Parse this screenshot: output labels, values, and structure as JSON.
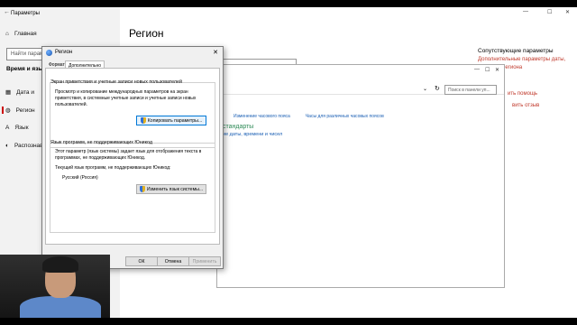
{
  "settings": {
    "title": "Параметры",
    "home": "Главная",
    "search_placeholder": "Найти парамет",
    "section": "Время и язык",
    "items": [
      "Дата и",
      "Регион",
      "Язык",
      "Распознав"
    ],
    "heading": "Регион",
    "related_heading": "Сопутствующие параметры",
    "related_link_1": "Дополнительные параметры даты,",
    "related_link_2": "региона",
    "help_link": "ить помощь",
    "feedback_link": "вить отзыв"
  },
  "control_panel": {
    "search_placeholder": "Поиск в панели уп...",
    "links": [
      "Изменение часового пояса",
      "Часы для различных часовых поясов"
    ],
    "green_heading": "стандарты",
    "sub_link": "ие даты, времени и чисел"
  },
  "dialog": {
    "title": "Регион",
    "tabs": [
      "Форматы",
      "Дополнительно"
    ],
    "group1_title": "Экран приветствия и учетные записи новых пользователей",
    "group1_text": [
      "Просмотр и копирование международных параметров на экран",
      "приветствия, в системные учетные записи и учетные записи новых",
      "пользователей."
    ],
    "copy_button": "Копировать параметры...",
    "group2_title": "Язык программ, не поддерживающих Юникод",
    "group2_text": [
      "Этот параметр (язык системы) задает язык для отображения текста в",
      "программах, не поддерживающих Юникод."
    ],
    "current_label": "Текущий язык программ, не поддерживающих Юникод:",
    "current_value": "Русский (Россия)",
    "change_button": "Изменить язык системы...",
    "ok": "ОК",
    "cancel": "Отмена",
    "apply": "Применить"
  }
}
